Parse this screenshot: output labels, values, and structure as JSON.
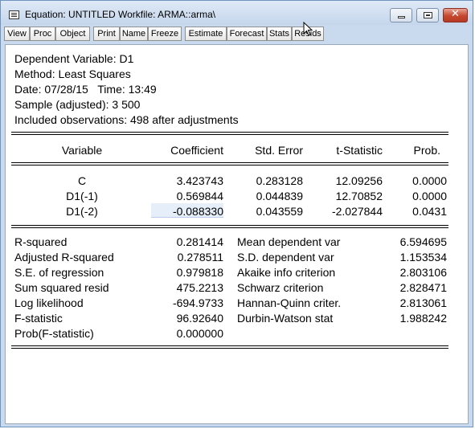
{
  "window": {
    "title": "Equation: UNTITLED",
    "workfile": "Workfile: ARMA::arma\\",
    "sys_icon": "equation-window-icon",
    "controls": {
      "minimize": "minimize-icon",
      "maximize": "maximize-icon",
      "close": "close-icon",
      "close_glyph": "✕"
    }
  },
  "toolbar": {
    "buttons": [
      "View",
      "Proc",
      "Object",
      "Print",
      "Name",
      "Freeze",
      "Estimate",
      "Forecast",
      "Stats",
      "Resids"
    ]
  },
  "header": {
    "dependent": "Dependent Variable: D1",
    "method": "Method: Least Squares",
    "date": "Date: 07/28/15   Time: 13:49",
    "sample": "Sample (adjusted): 3 500",
    "included": "Included observations: 498 after adjustments"
  },
  "coef_table": {
    "columns": [
      "Variable",
      "Coefficient",
      "Std. Error",
      "t-Statistic",
      "Prob."
    ],
    "rows": [
      [
        "C",
        "3.423743",
        "0.283128",
        "12.09256",
        "0.0000"
      ],
      [
        "D1(-1)",
        "0.569844",
        "0.044839",
        "12.70852",
        "0.0000"
      ],
      [
        "D1(-2)",
        "-0.088330",
        "0.043559",
        "-2.027844",
        "0.0431"
      ]
    ],
    "selected_cell": "D1(-2) Coefficient"
  },
  "stats": {
    "left": [
      [
        "R-squared",
        "0.281414"
      ],
      [
        "Adjusted R-squared",
        "0.278511"
      ],
      [
        "S.E. of regression",
        "0.979818"
      ],
      [
        "Sum squared resid",
        "475.2213"
      ],
      [
        "Log likelihood",
        "-694.9733"
      ],
      [
        "F-statistic",
        "96.92640"
      ],
      [
        "Prob(F-statistic)",
        "0.000000"
      ]
    ],
    "right": [
      [
        "Mean dependent var",
        "6.594695"
      ],
      [
        "S.D. dependent var",
        "1.153534"
      ],
      [
        "Akaike info criterion",
        "2.803106"
      ],
      [
        "Schwarz criterion",
        "2.828471"
      ],
      [
        "Hannan-Quinn criter.",
        "2.813061"
      ],
      [
        "Durbin-Watson stat",
        "1.988242"
      ]
    ]
  },
  "colors": {
    "title_bar": "#c9d9ee",
    "close_button": "#c5472f",
    "selection": "#e5eef9"
  }
}
